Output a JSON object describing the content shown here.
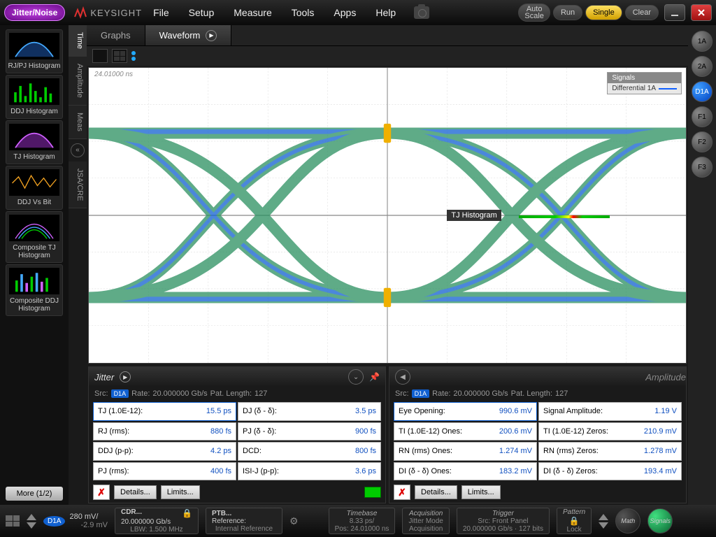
{
  "app": {
    "mode": "Jitter/Noise",
    "brand": "KEYSIGHT"
  },
  "menu": {
    "file": "File",
    "setup": "Setup",
    "measure": "Measure",
    "tools": "Tools",
    "apps": "Apps",
    "help": "Help"
  },
  "topbtn": {
    "autoscale_l1": "Auto",
    "autoscale_l2": "Scale",
    "run": "Run",
    "single": "Single",
    "clear": "Clear"
  },
  "left_thumbs": [
    {
      "id": "rjpj",
      "label": "RJ/PJ Histogram",
      "style": "blue-hist"
    },
    {
      "id": "ddj",
      "label": "DDJ Histogram",
      "style": "green-bars"
    },
    {
      "id": "tj",
      "label": "TJ Histogram",
      "style": "purple-hist"
    },
    {
      "id": "ddjvsbit",
      "label": "DDJ Vs Bit",
      "style": "orange-line"
    },
    {
      "id": "comptj",
      "label": "Composite TJ Histogram",
      "style": "multi-hist"
    },
    {
      "id": "compddj",
      "label": "Composite DDJ Histogram",
      "style": "multi-bars"
    }
  ],
  "more_btn": "More (1/2)",
  "vtabs": {
    "time": "Time",
    "amplitude": "Amplitude",
    "meas": "Meas",
    "jsa": "JSA/CRE"
  },
  "tabs": {
    "graphs": "Graphs",
    "waveform": "Waveform"
  },
  "plot": {
    "timestamp": "24.01000 ns",
    "legend_title": "Signals",
    "legend_item": "Differential 1A",
    "tj_label": "TJ Histogram"
  },
  "channels": [
    "1A",
    "2A",
    "D1A",
    "F1",
    "F2",
    "F3"
  ],
  "meas": {
    "jitter_title": "Jitter",
    "amp_title": "Amplitude",
    "src_label": "Src:",
    "src_chip": "D1A",
    "rate_label": "Rate:",
    "rate_val": "20.000000 Gb/s",
    "pat_label": "Pat. Length:",
    "pat_val": "127",
    "jitter_cells": [
      {
        "l": "TJ (1.0E-12):",
        "v": "15.5 ps"
      },
      {
        "l": "DJ (δ - δ):",
        "v": "3.5 ps"
      },
      {
        "l": "RJ (rms):",
        "v": "880 fs"
      },
      {
        "l": "PJ (δ - δ):",
        "v": "900 fs"
      },
      {
        "l": "DDJ (p-p):",
        "v": "4.2 ps"
      },
      {
        "l": "DCD:",
        "v": "800 fs"
      },
      {
        "l": "PJ (rms):",
        "v": "400 fs"
      },
      {
        "l": "ISI-J (p-p):",
        "v": "3.6 ps"
      }
    ],
    "amp_cells": [
      {
        "l": "Eye Opening:",
        "v": "990.6 mV"
      },
      {
        "l": "Signal Amplitude:",
        "v": "1.19 V"
      },
      {
        "l": "TI (1.0E-12) Ones:",
        "v": "200.6 mV"
      },
      {
        "l": "TI (1.0E-12) Zeros:",
        "v": "210.9 mV"
      },
      {
        "l": "RN (rms) Ones:",
        "v": "1.274 mV"
      },
      {
        "l": "RN (rms) Zeros:",
        "v": "1.278 mV"
      },
      {
        "l": "DI (δ - δ) Ones:",
        "v": "183.2 mV"
      },
      {
        "l": "DI (δ - δ) Zeros:",
        "v": "193.4 mV"
      }
    ],
    "details_btn": "Details...",
    "limits_btn": "Limits..."
  },
  "status": {
    "scale1": "280 mV/",
    "scale2": "-2.9 mV",
    "cdr_title": "CDR...",
    "cdr_l1": "20.000000 Gb/s",
    "cdr_l2": "LBW: 1.500 MHz",
    "ptb_title": "PTB...",
    "ptb_l1": "Reference:",
    "ptb_l2": "Internal Reference",
    "tb_title": "Timebase",
    "tb_l1": "8.33 ps/",
    "tb_l2": "Pos: 24.01000 ns",
    "acq_title": "Acquisition",
    "acq_l1": "Jitter Mode",
    "acq_l2": "Acquisition",
    "trg_title": "Trigger",
    "trg_l1": "Src: Front Panel",
    "trg_l2": "20.000000 Gb/s",
    "trg_l3": "127 bits",
    "pat_title": "Pattern",
    "pat_sub": "Lock",
    "math": "Math",
    "signals": "Signals"
  }
}
